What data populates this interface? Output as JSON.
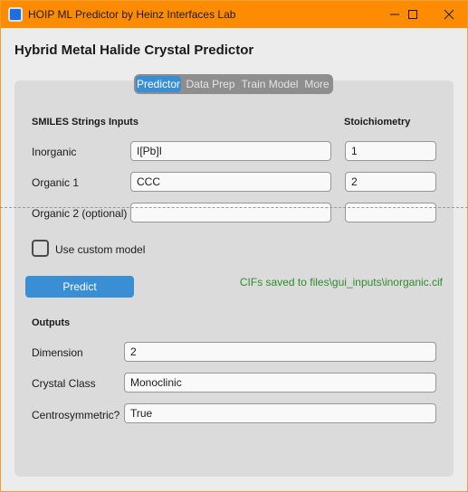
{
  "window": {
    "title": "HOIP ML Predictor by Heinz Interfaces Lab",
    "icon": "app-icon",
    "controls": [
      "minimize-icon",
      "maximize-icon",
      "close-icon"
    ]
  },
  "app_title": "Hybrid Metal Halide Crystal Predictor",
  "tabs": [
    {
      "label": "Predictor",
      "active": true
    },
    {
      "label": "Data Prep",
      "active": false
    },
    {
      "label": "Train Model",
      "active": false
    },
    {
      "label": "More",
      "active": false
    }
  ],
  "inputs": {
    "smiles_heading": "SMILES Strings Inputs",
    "stoich_heading": "Stoichiometry",
    "rows": [
      {
        "label": "Inorganic",
        "smiles": "I[Pb]I",
        "stoich": "1"
      },
      {
        "label": "Organic 1",
        "smiles": "CCC",
        "stoich": "2"
      },
      {
        "label": "Organic 2 (optional)",
        "smiles": "",
        "stoich": ""
      }
    ]
  },
  "custom_model": {
    "label": "Use custom model",
    "checked": false
  },
  "predict_button": "Predict",
  "status": "CIFs saved to files\\gui_inputs\\inorganic.cif",
  "outputs": {
    "heading": "Outputs",
    "rows": [
      {
        "label": "Dimension",
        "value": "2"
      },
      {
        "label": "Crystal Class",
        "value": "Monoclinic"
      },
      {
        "label": "Centrosymmetric?",
        "value": "True"
      }
    ]
  },
  "colors": {
    "titlebar": "#ff8c00",
    "accent": "#3a8ed4",
    "status": "#2e8b2e"
  }
}
